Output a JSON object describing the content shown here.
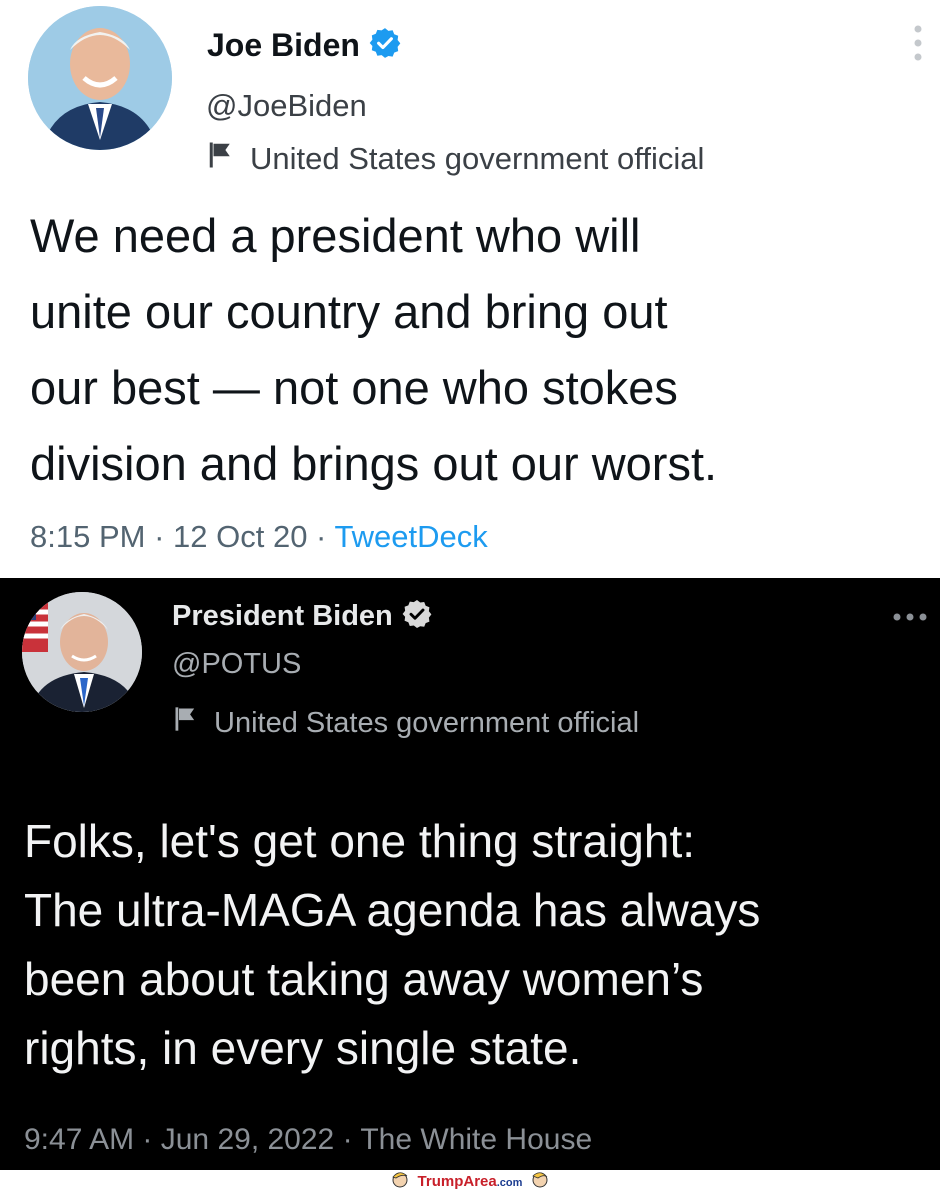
{
  "tweets": [
    {
      "display_name": "Joe Biden",
      "handle": "@JoeBiden",
      "label": "United States government official",
      "text": "We need a president who will\nunite our country and bring out\nour best — not one who stokes\ndivision and brings out our worst.",
      "time": "8:15 PM",
      "date": "12 Oct 20",
      "source": "TweetDeck",
      "separator": " · ",
      "theme": "light"
    },
    {
      "display_name": "President Biden",
      "handle": "@POTUS",
      "label": "United States government official",
      "text": "Folks, let's get one thing straight:\nThe ultra-MAGA agenda has always\nbeen about taking away women’s\nrights, in every single state.",
      "time": "9:47 AM",
      "date": "Jun 29, 2022",
      "source": "The White House",
      "separator": " · ",
      "theme": "dark"
    }
  ],
  "watermark": {
    "brand": "TrumpArea",
    "suffix": ".com",
    "brand_color": "#c8202a",
    "suffix_color": "#1a3b8f"
  },
  "colors": {
    "verified_blue": "#1d9bf0",
    "link_blue": "#1d9bf0",
    "dark_bg": "#000000",
    "light_bg": "#ffffff"
  },
  "icons": [
    "verified-badge-icon",
    "flag-icon",
    "more-options-icon",
    "profile-avatar"
  ]
}
